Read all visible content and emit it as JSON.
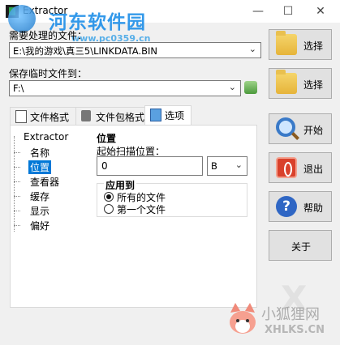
{
  "window": {
    "title": "Extractor",
    "minimize_glyph": "—",
    "maximize_glyph": "☐",
    "close_glyph": "✕"
  },
  "watermark": {
    "site_name": "河东软件园",
    "url": "www.pc0359.cn",
    "bottom_name": "小狐狸网",
    "bottom_url": "XHLKS.CN"
  },
  "source": {
    "label": "需要处理的文件：",
    "value": "E:\\我的游戏\\真三5\\LINKDATA.BIN",
    "browse_label": "选择"
  },
  "temp": {
    "label": "保存临时文件到：",
    "value": "F:\\",
    "browse_label": "选择"
  },
  "tabs": [
    {
      "label": "文件格式",
      "icon": "document-icon"
    },
    {
      "label": "文件包格式",
      "icon": "book-icon"
    },
    {
      "label": "选项",
      "icon": "options-icon",
      "active": true
    }
  ],
  "tree": {
    "root": "Extractor",
    "items": [
      "名称",
      "位置",
      "查看器",
      "缓存",
      "显示",
      "偏好"
    ],
    "selected": "位置"
  },
  "position_settings": {
    "title": "位置",
    "start_offset_label": "起始扫描位置：",
    "start_offset_value": "0",
    "unit_value": "B",
    "apply_to_title": "应用到",
    "options": [
      "所有的文件",
      "第一个文件"
    ],
    "selected_option": "所有的文件"
  },
  "actions": {
    "start": "开始",
    "exit": "退出",
    "help": "帮助",
    "about": "关于"
  },
  "colors": {
    "selection": "#0078d7",
    "background": "#f0f0f0"
  }
}
